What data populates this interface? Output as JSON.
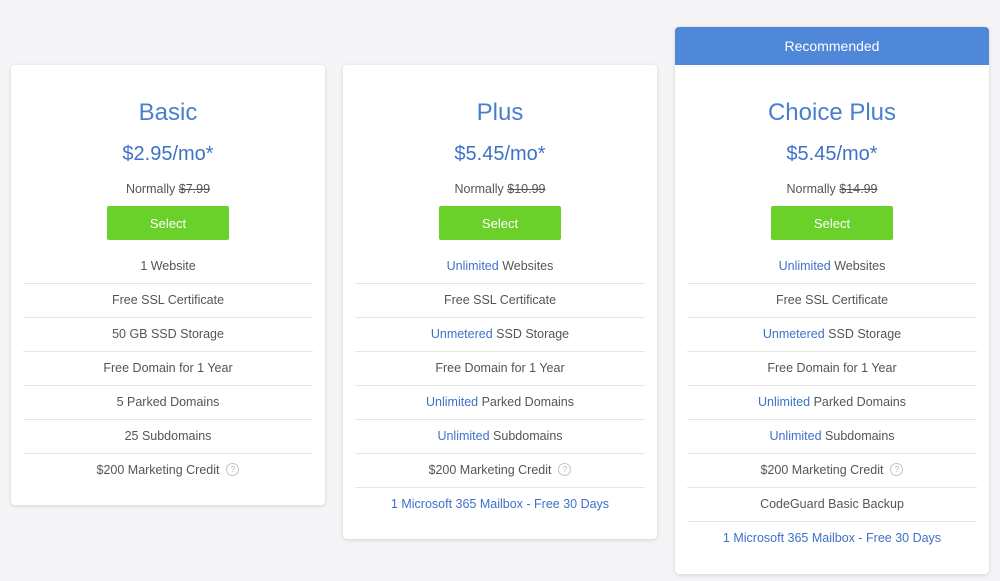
{
  "recommended_label": "Recommended",
  "select_label": "Select",
  "plans": [
    {
      "name": "Basic",
      "price": "$2.95/mo*",
      "normally_label": "Normally",
      "normal_price": "$7.99",
      "features": {
        "websites": {
          "hl": "",
          "text": "1 Website"
        },
        "ssl": "Free SSL Certificate",
        "storage": {
          "hl": "",
          "text": "50 GB SSD Storage"
        },
        "domain": "Free Domain for 1 Year",
        "parked": {
          "hl": "",
          "text": "5 Parked Domains"
        },
        "subdomains": {
          "hl": "",
          "text": "25 Subdomains"
        },
        "marketing": "$200 Marketing Credit"
      }
    },
    {
      "name": "Plus",
      "price": "$5.45/mo*",
      "normally_label": "Normally",
      "normal_price": "$10.99",
      "features": {
        "websites": {
          "hl": "Unlimited",
          "text": "Websites"
        },
        "ssl": "Free SSL Certificate",
        "storage": {
          "hl": "Unmetered",
          "text": "SSD Storage"
        },
        "domain": "Free Domain for 1 Year",
        "parked": {
          "hl": "Unlimited",
          "text": "Parked Domains"
        },
        "subdomains": {
          "hl": "Unlimited",
          "text": "Subdomains"
        },
        "marketing": "$200 Marketing Credit",
        "mailbox": "1 Microsoft 365 Mailbox - Free 30 Days"
      }
    },
    {
      "name": "Choice Plus",
      "price": "$5.45/mo*",
      "normally_label": "Normally",
      "normal_price": "$14.99",
      "features": {
        "websites": {
          "hl": "Unlimited",
          "text": "Websites"
        },
        "ssl": "Free SSL Certificate",
        "storage": {
          "hl": "Unmetered",
          "text": "SSD Storage"
        },
        "domain": "Free Domain for 1 Year",
        "parked": {
          "hl": "Unlimited",
          "text": "Parked Domains"
        },
        "subdomains": {
          "hl": "Unlimited",
          "text": "Subdomains"
        },
        "marketing": "$200 Marketing Credit",
        "backup": "CodeGuard Basic Backup",
        "mailbox": "1 Microsoft 365 Mailbox - Free 30 Days"
      }
    }
  ],
  "icons": {
    "info": "info-icon"
  },
  "colors": {
    "accent": "#3d72c9",
    "button": "#6ad02a",
    "banner": "#4f87d9"
  }
}
